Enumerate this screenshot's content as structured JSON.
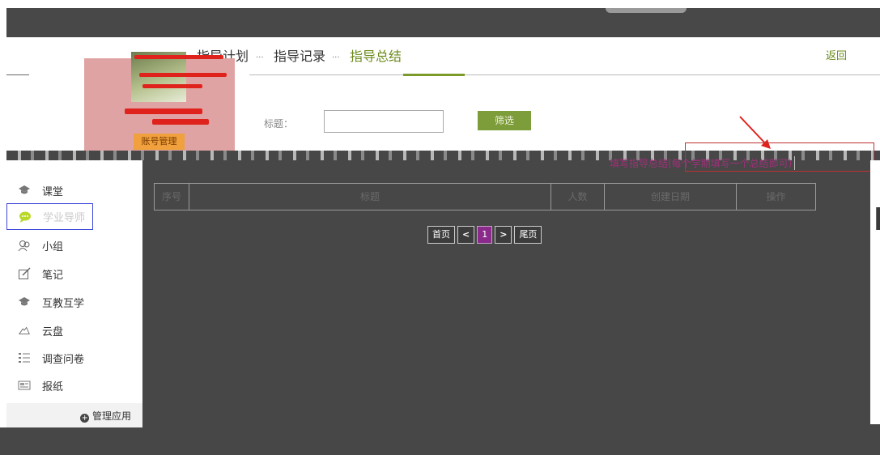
{
  "header": {
    "tabs": [
      {
        "label": "指导计划"
      },
      {
        "label": "指导记录"
      },
      {
        "label": "指导总结"
      }
    ],
    "back_label": "返回"
  },
  "profile": {
    "account_button": "账号管理"
  },
  "filter": {
    "label": "标题：",
    "button": "筛选"
  },
  "tip": {
    "text": "填写指导总结(每个学期填写一个总结即可)"
  },
  "sidebar": {
    "items": [
      {
        "label": "课堂",
        "icon": "graduation-cap-icon"
      },
      {
        "label": "学业导师",
        "icon": "chat-bubble-icon"
      },
      {
        "label": "小组",
        "icon": "group-icon"
      },
      {
        "label": "笔记",
        "icon": "note-edit-icon"
      },
      {
        "label": "互教互学",
        "icon": "graduation-cap-icon"
      },
      {
        "label": "云盘",
        "icon": "cloud-icon"
      },
      {
        "label": "调查问卷",
        "icon": "list-icon"
      },
      {
        "label": "报纸",
        "icon": "newspaper-icon"
      }
    ],
    "manage_apps": "管理应用"
  },
  "table": {
    "columns": [
      "序号",
      "标题",
      "人数",
      "创建日期",
      "操作"
    ]
  },
  "pager": {
    "first": "首页",
    "prev": "<",
    "current": "1",
    "next": ">",
    "last": "尾页"
  },
  "colors": {
    "accent_green": "#7d9c3a",
    "overlay": "#474747",
    "current_page": "#8a2a8a",
    "tip_text": "#a0307a"
  }
}
